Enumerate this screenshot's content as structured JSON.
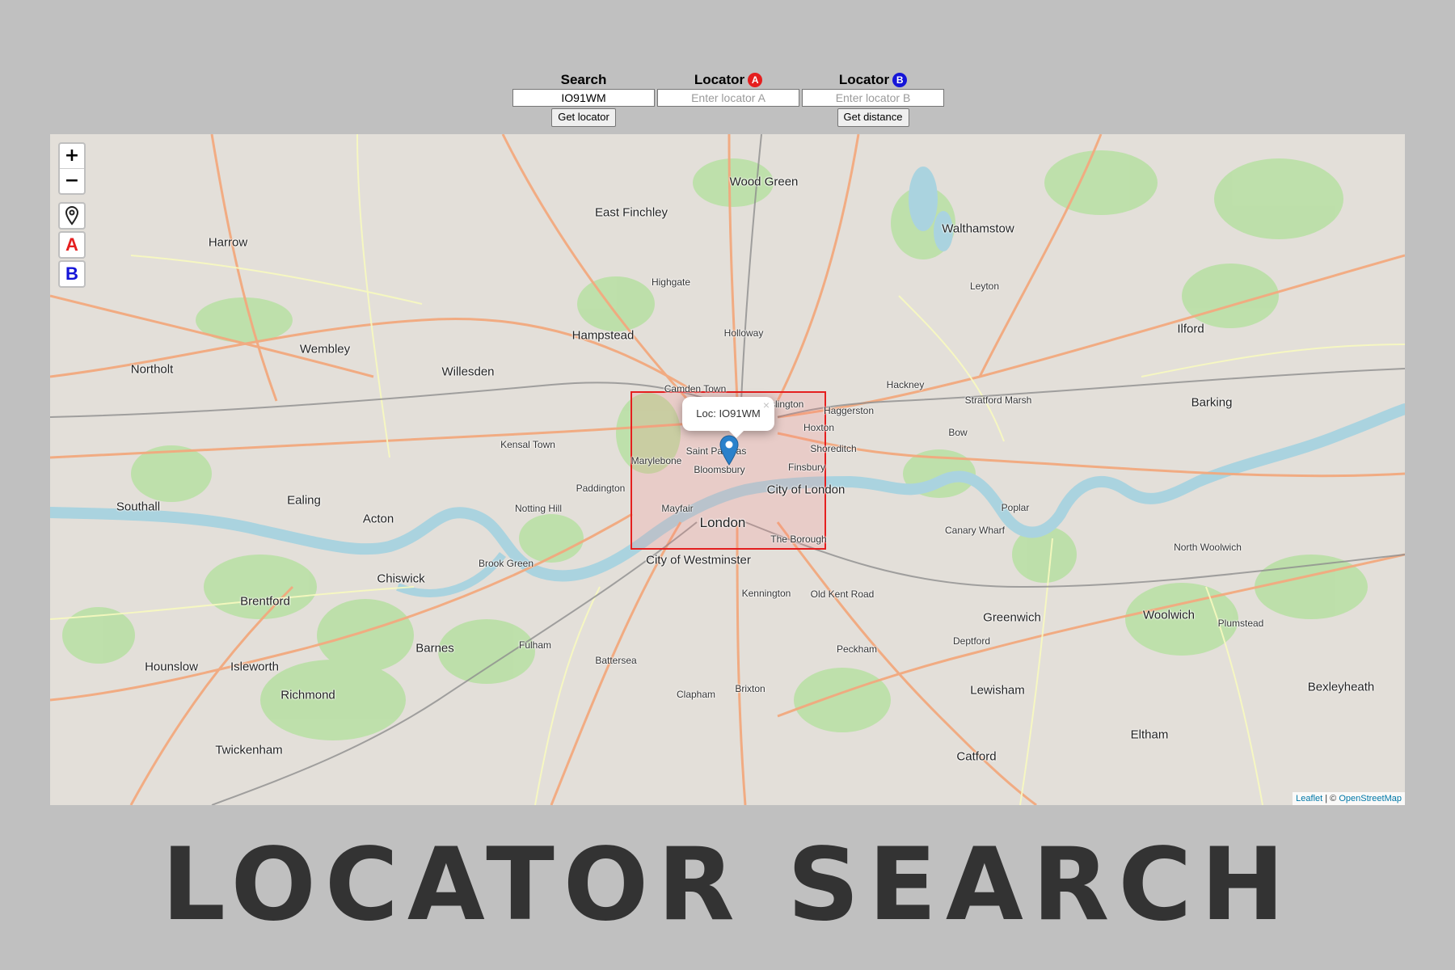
{
  "controls": {
    "search": {
      "label": "Search",
      "value": "IO91WM",
      "button": "Get locator"
    },
    "locator_a": {
      "label": "Locator",
      "badge": "A",
      "badge_color": "#e51f1f",
      "placeholder": "Enter locator A"
    },
    "locator_b": {
      "label": "Locator",
      "badge": "B",
      "badge_color": "#1515d8",
      "placeholder": "Enter locator B",
      "button": "Get distance"
    }
  },
  "map": {
    "zoom_in": "+",
    "zoom_out": "−",
    "tool_marker_icon": "map-pin-icon",
    "tool_a_label": "A",
    "tool_b_label": "B",
    "popup_text": "Loc: IO91WM",
    "popup_close": "×",
    "selection_color": "#e51f1f",
    "attribution": {
      "leaflet": "Leaflet",
      "separator": " | © ",
      "osm": "OpenStreetMap"
    },
    "places": {
      "london": "London",
      "city_of_london": "City of London",
      "city_of_westminster": "City of Westminster",
      "camden_town": "Camden Town",
      "islington": "Islington",
      "hoxton": "Hoxton",
      "shoreditch": "Shoreditch",
      "finsbury": "Finsbury",
      "bloomsbury": "Bloomsbury",
      "marylebone": "Marylebone",
      "saint_pancras": "Saint Pancras",
      "mayfair": "Mayfair",
      "the_borough": "The Borough",
      "haggerston": "Haggerston",
      "hampstead": "Hampstead",
      "willesden": "Willesden",
      "wembley": "Wembley",
      "harrow": "Harrow",
      "ealing": "Ealing",
      "acton": "Acton",
      "chiswick": "Chiswick",
      "brentford": "Brentford",
      "richmond": "Richmond",
      "barnes": "Barnes",
      "clapham": "Clapham",
      "brixton": "Brixton",
      "lewisham": "Lewisham",
      "greenwich": "Greenwich",
      "woolwich": "Woolwich",
      "barking": "Barking",
      "ilford": "Ilford",
      "walthamstow": "Walthamstow",
      "wood_green": "Wood Green",
      "east_finchley": "East Finchley",
      "stratford_marsh": "Stratford Marsh",
      "southall": "Southall",
      "northolt": "Northolt",
      "hounslow": "Hounslow",
      "isleworth": "Isleworth",
      "twickenham": "Twickenham",
      "eltham": "Eltham",
      "catford": "Catford",
      "bexleyheath": "Bexleyheath",
      "peckham": "Peckham",
      "hackney": "Hackney",
      "bow": "Bow",
      "poplar": "Poplar",
      "canary_wharf": "Canary Wharf",
      "kensal_town": "Kensal Town",
      "paddington": "Paddington",
      "notting_hill": "Notting Hill",
      "brook_green": "Brook Green",
      "fulham": "Fulham",
      "battersea": "Battersea",
      "kennington": "Kennington",
      "old_kent_road": "Old Kent Road",
      "deptford": "Deptford",
      "highgate": "Highgate",
      "holloway": "Holloway",
      "leyton": "Leyton",
      "north_woolwich": "North Woolwich",
      "plumstead": "Plumstead"
    }
  },
  "headline": "LOCATOR SEARCH"
}
